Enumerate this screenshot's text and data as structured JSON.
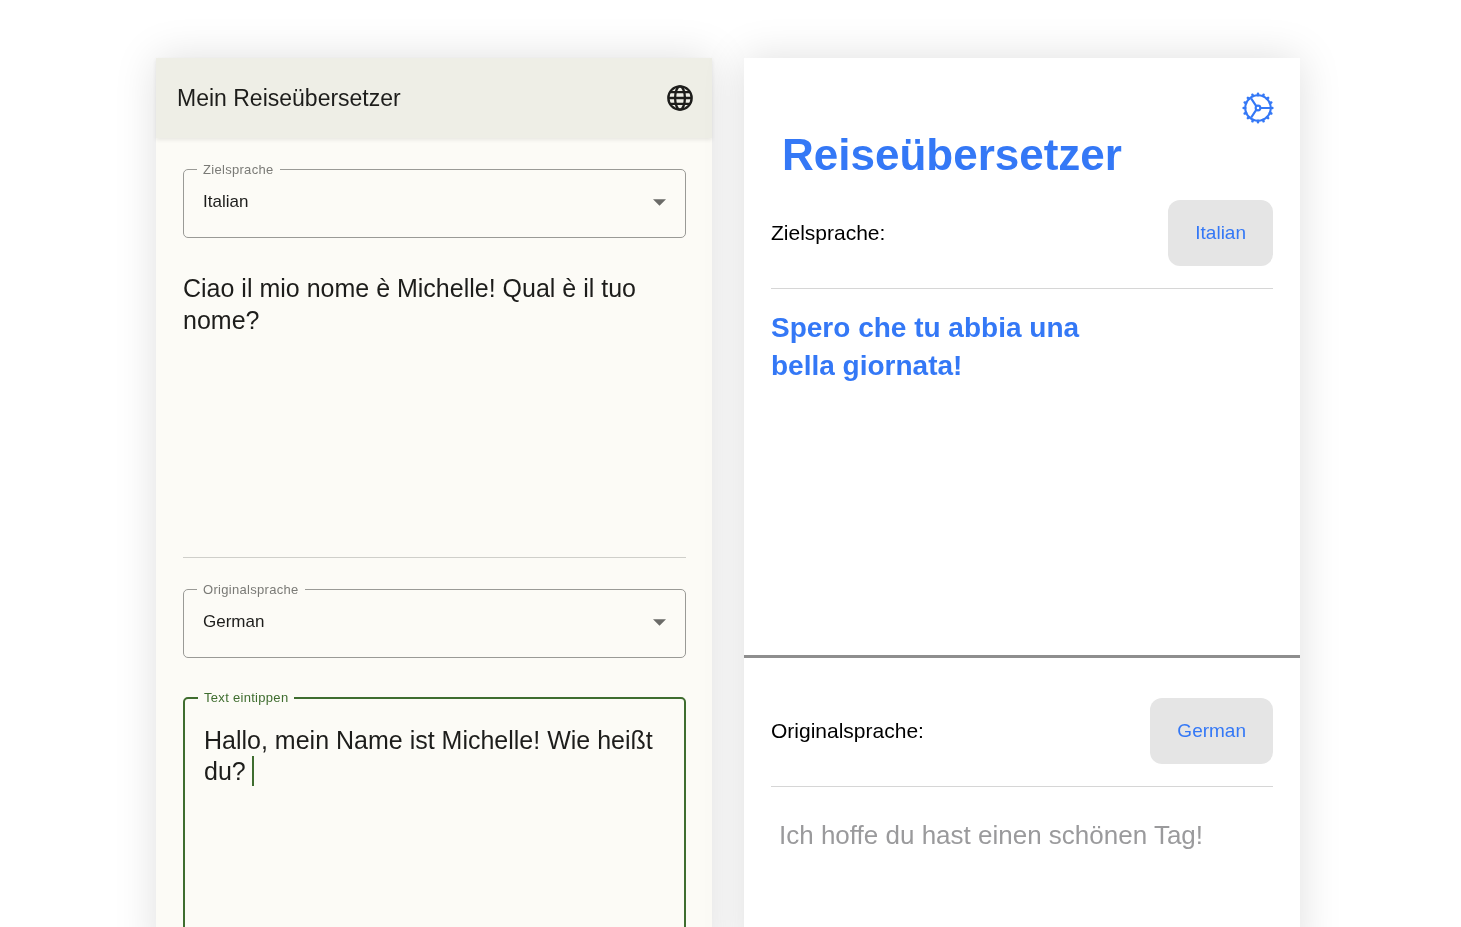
{
  "android_app": {
    "title": "Mein Reiseübersetzer",
    "target_select": {
      "label": "Zielsprache",
      "value": "Italian"
    },
    "translation": "Ciao il mio nome è Michelle! Qual è il tuo nome?",
    "source_select": {
      "label": "Originalsprache",
      "value": "German"
    },
    "input": {
      "label": "Text eintippen",
      "value": "Hallo, mein Name ist Michelle! Wie heißt du?",
      "focused": true
    }
  },
  "ios_app": {
    "title": "Reiseübersetzer",
    "target": {
      "label": "Zielsprache:",
      "value": "Italian"
    },
    "translation": "Spero che tu abbia una bella giornata!",
    "source": {
      "label": "Originalsprache:",
      "value": "German"
    },
    "input": {
      "placeholder": "Ich hoffe du hast einen schönen Tag!"
    }
  }
}
